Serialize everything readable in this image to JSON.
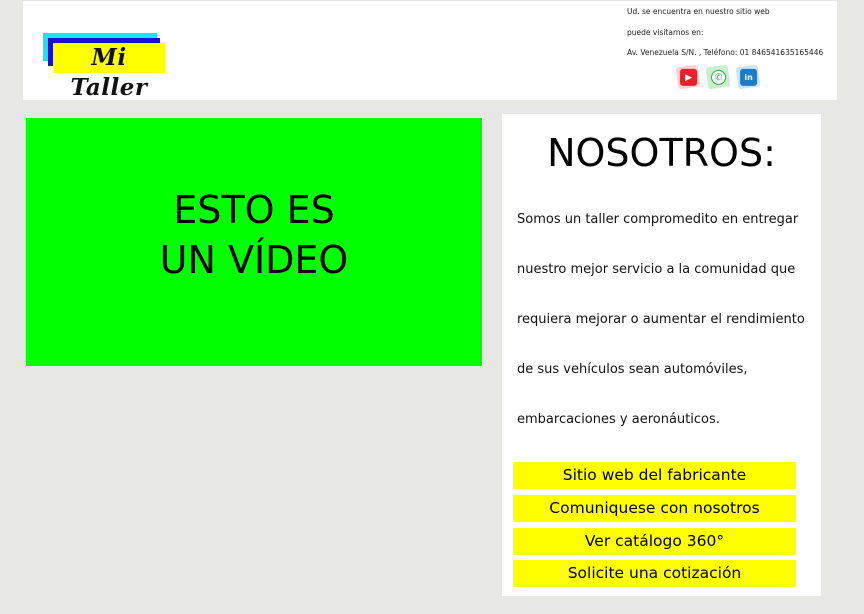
{
  "header": {
    "logo_text": "Mi Taller",
    "contact_line1": "Ud. se encuentra en nuestro sitio web",
    "contact_line2": "puede visitarnos en:",
    "contact_line3": "Av. Venezuela S/N. , Teléfono: 01 846541635165446",
    "social": [
      {
        "icon": "youtube-icon",
        "glyph": "▶"
      },
      {
        "icon": "whatsapp-icon",
        "glyph": "✆"
      },
      {
        "icon": "linkedin-icon",
        "glyph": "in"
      }
    ]
  },
  "video": {
    "line1": "ESTO ES",
    "line2": "UN VÍDEO"
  },
  "about": {
    "title": "NOSOTROS:",
    "paragraph_lines": [
      "Somos un taller compromedito en entregar",
      "nuestro mejor servicio a la comunidad que",
      "requiera mejorar o aumentar el rendimiento",
      "de sus vehículos sean automóviles,",
      "embarcaciones y aeronáuticos."
    ],
    "buttons": [
      "Sitio web del fabricante",
      "Comuniquese con nosotros",
      "Ver catálogo 360°",
      "Solicite una cotización"
    ]
  },
  "colors": {
    "background": "#e7e7e5",
    "video_bg": "#00ff00",
    "button_bg": "#ffff00",
    "logo_cyan": "#19e3f0",
    "logo_blue": "#1d0fd1",
    "logo_yellow": "#ffff00"
  }
}
